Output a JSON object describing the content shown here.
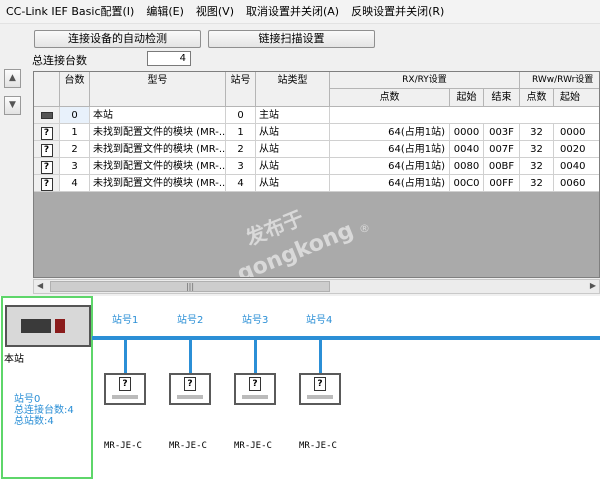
{
  "menu": [
    "CC-Link IEF Basic配置(I)",
    "编辑(E)",
    "视图(V)",
    "取消设置并关闭(A)",
    "反映设置并关闭(R)"
  ],
  "toolbar": {
    "auto_detect": "连接设备的自动检测",
    "link_scan": "链接扫描设置"
  },
  "count": {
    "label": "总连接台数",
    "value": "4"
  },
  "table": {
    "headers": {
      "unit": "台数",
      "model": "型号",
      "station_no": "站号",
      "station_type": "站类型",
      "rxry": "RX/RY设置",
      "rwwr": "RWw/RWr设置",
      "points": "点数",
      "start": "起始",
      "end": "结束",
      "points2": "点数",
      "start2": "起始"
    },
    "rows": [
      {
        "unit": "0",
        "model": "本站",
        "station_no": "0",
        "station_type": "主站",
        "points": "",
        "start": "",
        "end": "",
        "points2": "",
        "start2": ""
      },
      {
        "unit": "1",
        "model": "未找到配置文件的模块 (MR-...",
        "station_no": "1",
        "station_type": "从站",
        "points": "64(占用1站)",
        "start": "0000",
        "end": "003F",
        "points2": "32",
        "start2": "0000"
      },
      {
        "unit": "2",
        "model": "未找到配置文件的模块 (MR-...",
        "station_no": "2",
        "station_type": "从站",
        "points": "64(占用1站)",
        "start": "0040",
        "end": "007F",
        "points2": "32",
        "start2": "0020"
      },
      {
        "unit": "3",
        "model": "未找到配置文件的模块 (MR-...",
        "station_no": "3",
        "station_type": "从站",
        "points": "64(占用1站)",
        "start": "0080",
        "end": "00BF",
        "points2": "32",
        "start2": "0040"
      },
      {
        "unit": "4",
        "model": "未找到配置文件的模块 (MR-...",
        "station_no": "4",
        "station_type": "从站",
        "points": "64(占用1站)",
        "start": "00C0",
        "end": "00FF",
        "points2": "32",
        "start2": "0060"
      }
    ],
    "scroll_thumb": "|||"
  },
  "watermark": {
    "line1": "发布于",
    "line2": "gongkong",
    "mark": "®"
  },
  "diagram": {
    "master_label": "本站",
    "master_info": [
      "站号0",
      "总连接台数:4",
      "总站数:4"
    ],
    "stations": [
      {
        "label": "站号1",
        "model": "MR-JE-C"
      },
      {
        "label": "站号2",
        "model": "MR-JE-C"
      },
      {
        "label": "站号3",
        "model": "MR-JE-C"
      },
      {
        "label": "站号4",
        "model": "MR-JE-C"
      }
    ],
    "unknown_glyph": "?"
  },
  "colors": {
    "bus": "#2b8fd6",
    "master_frame": "#5ed66a",
    "grid_bg": "#aaaaaa",
    "info_text": "#2b8fd6"
  }
}
